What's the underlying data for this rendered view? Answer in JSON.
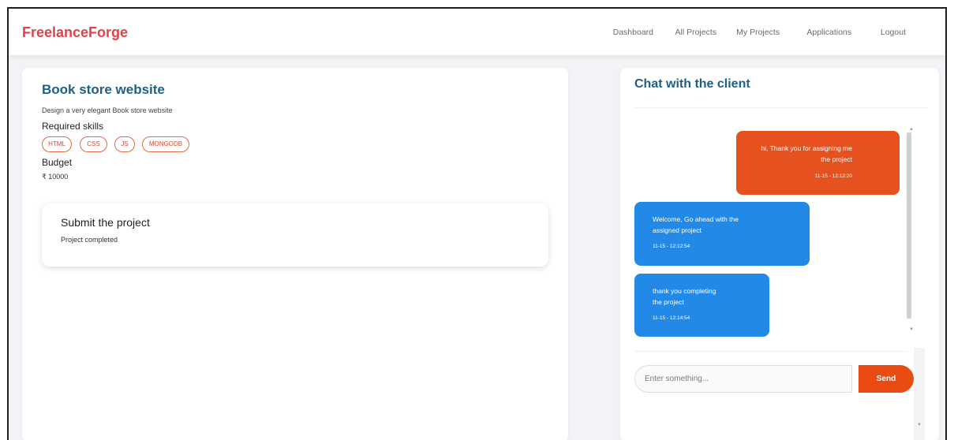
{
  "navbar": {
    "brand": "FreelanceForge",
    "links": [
      {
        "label": "Dashboard"
      },
      {
        "label": "All Projects"
      },
      {
        "label": "My Projects"
      },
      {
        "label": "Applications"
      },
      {
        "label": "Logout"
      }
    ]
  },
  "project": {
    "title": "Book store website",
    "description": "Design a very elegant Book store website",
    "skills_heading": "Required skills",
    "skills": [
      "HTML",
      "CSS",
      "JS",
      "MONGODB"
    ],
    "budget_heading": "Budget",
    "budget_value": "₹ 10000"
  },
  "submission": {
    "title": "Submit the project",
    "status": "Project completed"
  },
  "chat": {
    "title": "Chat with the client",
    "messages": [
      {
        "side": "sent",
        "lines": [
          "hi, Thank you for assigning me",
          "the project"
        ],
        "time": "11-15 - 12:12:20"
      },
      {
        "side": "received",
        "lines": [
          "Welcome, Go ahead with the",
          "assigned project"
        ],
        "time": "11-15 - 12:12:54"
      },
      {
        "side": "received",
        "lines": [
          "thank you completing",
          "the project"
        ],
        "time": "11-15 - 12:14:54"
      }
    ],
    "input_placeholder": "Enter something...",
    "send_label": "Send"
  },
  "colors": {
    "brand": "#e0424d",
    "heading": "#1f5f80",
    "accent_orange": "#ea4b12",
    "bubble_sent": "#e5511f",
    "bubble_received": "#228ae6"
  },
  "icons": {
    "scroll_up": "▲",
    "scroll_down": "▼"
  }
}
